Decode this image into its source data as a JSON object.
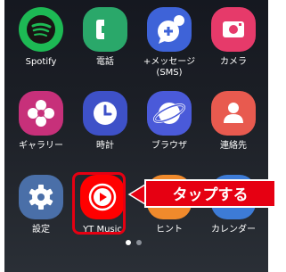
{
  "apps": [
    {
      "label": "Spotify",
      "icon": "spotify-icon",
      "color": "#1db954"
    },
    {
      "label": "電話",
      "icon": "phone-icon",
      "color": "#2aa86a"
    },
    {
      "label": "+メッセージ\n(SMS)",
      "icon": "message-icon",
      "color": "#3e63d8"
    },
    {
      "label": "カメラ",
      "icon": "camera-icon",
      "color": "#e63a6a"
    },
    {
      "label": "ギャラリー",
      "icon": "gallery-icon",
      "color": "#c7307a"
    },
    {
      "label": "時計",
      "icon": "clock-icon",
      "color": "#3e51c8"
    },
    {
      "label": "ブラウザ",
      "icon": "browser-icon",
      "color": "#4a5ad9"
    },
    {
      "label": "連絡先",
      "icon": "contacts-icon",
      "color": "#e85a4f"
    },
    {
      "label": "設定",
      "icon": "settings-icon",
      "color": "#4a6fa8"
    },
    {
      "label": "YT Music",
      "icon": "yt-music-icon",
      "color": "#ff0000"
    },
    {
      "label": "ヒント",
      "icon": "tips-icon",
      "color": "#f08a2c"
    },
    {
      "label": "カレンダー",
      "icon": "calendar-icon",
      "color": "#3d7bd6"
    }
  ],
  "callout": {
    "text": "タップする",
    "color": "#e60012"
  },
  "page_indicator": {
    "count": 2,
    "active": 1
  }
}
